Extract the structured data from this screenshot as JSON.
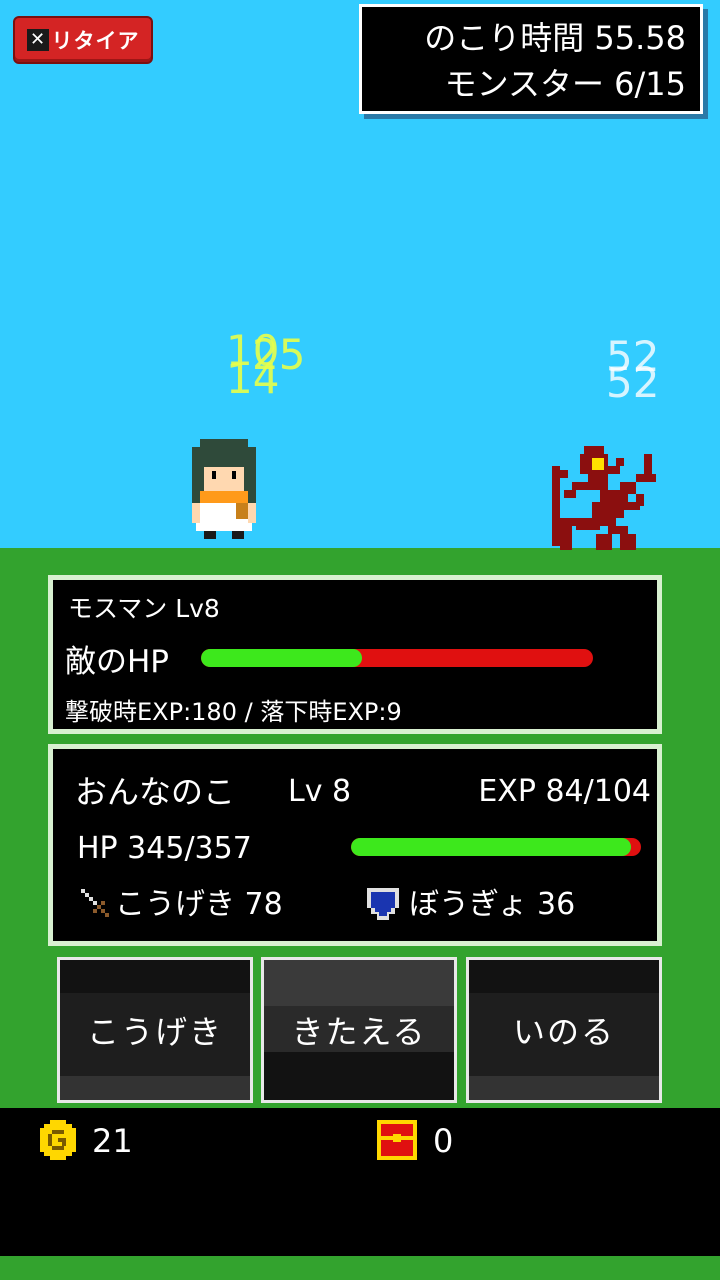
{
  "hud": {
    "retire_x": "✕",
    "retire_label": "リタイア",
    "time_label": "のこり時間 55.58",
    "monster_label": "モンスター 6/15"
  },
  "damage_numbers": {
    "hero_stack": [
      "10",
      "25",
      "14"
    ],
    "enemy_stack": [
      "52",
      "52"
    ]
  },
  "enemy": {
    "name": "モスマン Lv8",
    "hp_label": "敵のHP",
    "hp_ratio": 0.41,
    "exp_info": "撃破時EXP:180 / 落下時EXP:9"
  },
  "player": {
    "name": "おんなのこ",
    "level": "Lv 8",
    "exp": "EXP 84/104",
    "hp_text": "HP 345/357",
    "hp_ratio": 0.966,
    "attack": "こうげき 78",
    "defense": "ぼうぎょ 36",
    "attack_icon": "sword-icon",
    "defense_icon": "shield-icon"
  },
  "commands": {
    "attack": "こうげき",
    "train": "きたえる",
    "pray": "いのる"
  },
  "footer": {
    "gold": "21",
    "chests": "0",
    "gold_icon": "gold-coin-icon",
    "chest_icon": "treasure-chest-icon"
  },
  "colors": {
    "sky": "#33ccff",
    "field": "#33a32e",
    "hp_fill": "#3de81c",
    "hp_empty": "#e01010",
    "retire_button": "#d42424",
    "gold": "#ffd700"
  }
}
